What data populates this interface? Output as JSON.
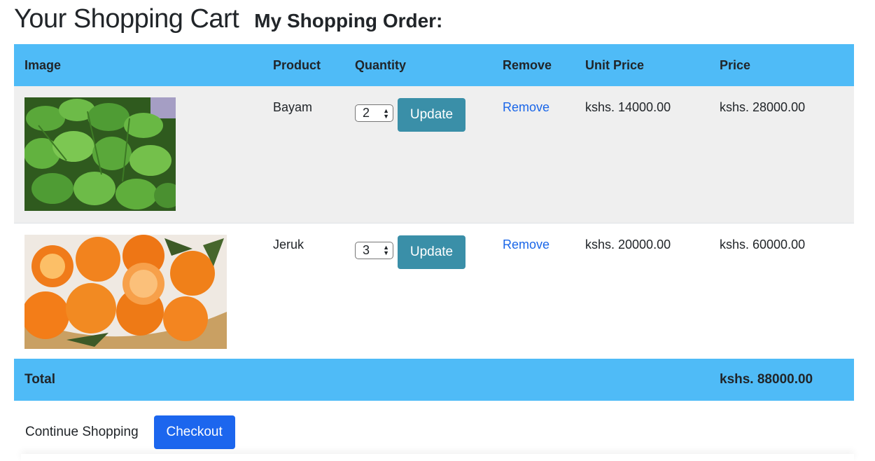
{
  "header": {
    "cart_title": "Your Shopping Cart",
    "order_title": "My Shopping Order:"
  },
  "table": {
    "columns": [
      "Image",
      "Product",
      "Quantity",
      "Remove",
      "Unit Price",
      "Price"
    ],
    "rows": [
      {
        "product": "Bayam",
        "image": "spinach-image",
        "quantity": "2",
        "update_label": "Update",
        "remove_label": "Remove",
        "unit_price": "kshs. 14000.00",
        "price": "kshs. 28000.00"
      },
      {
        "product": "Jeruk",
        "image": "orange-image",
        "quantity": "3",
        "update_label": "Update",
        "remove_label": "Remove",
        "unit_price": "kshs. 20000.00",
        "price": "kshs. 60000.00"
      }
    ],
    "total_label": "Total",
    "total_value": "kshs. 88000.00"
  },
  "actions": {
    "continue_label": "Continue Shopping",
    "checkout_label": "Checkout"
  },
  "colors": {
    "header_bg": "#4fbbf7",
    "update_button": "#3a8fa8",
    "checkout_button": "#1c66ee",
    "link": "#1a66e8",
    "odd_row": "#efefef"
  }
}
